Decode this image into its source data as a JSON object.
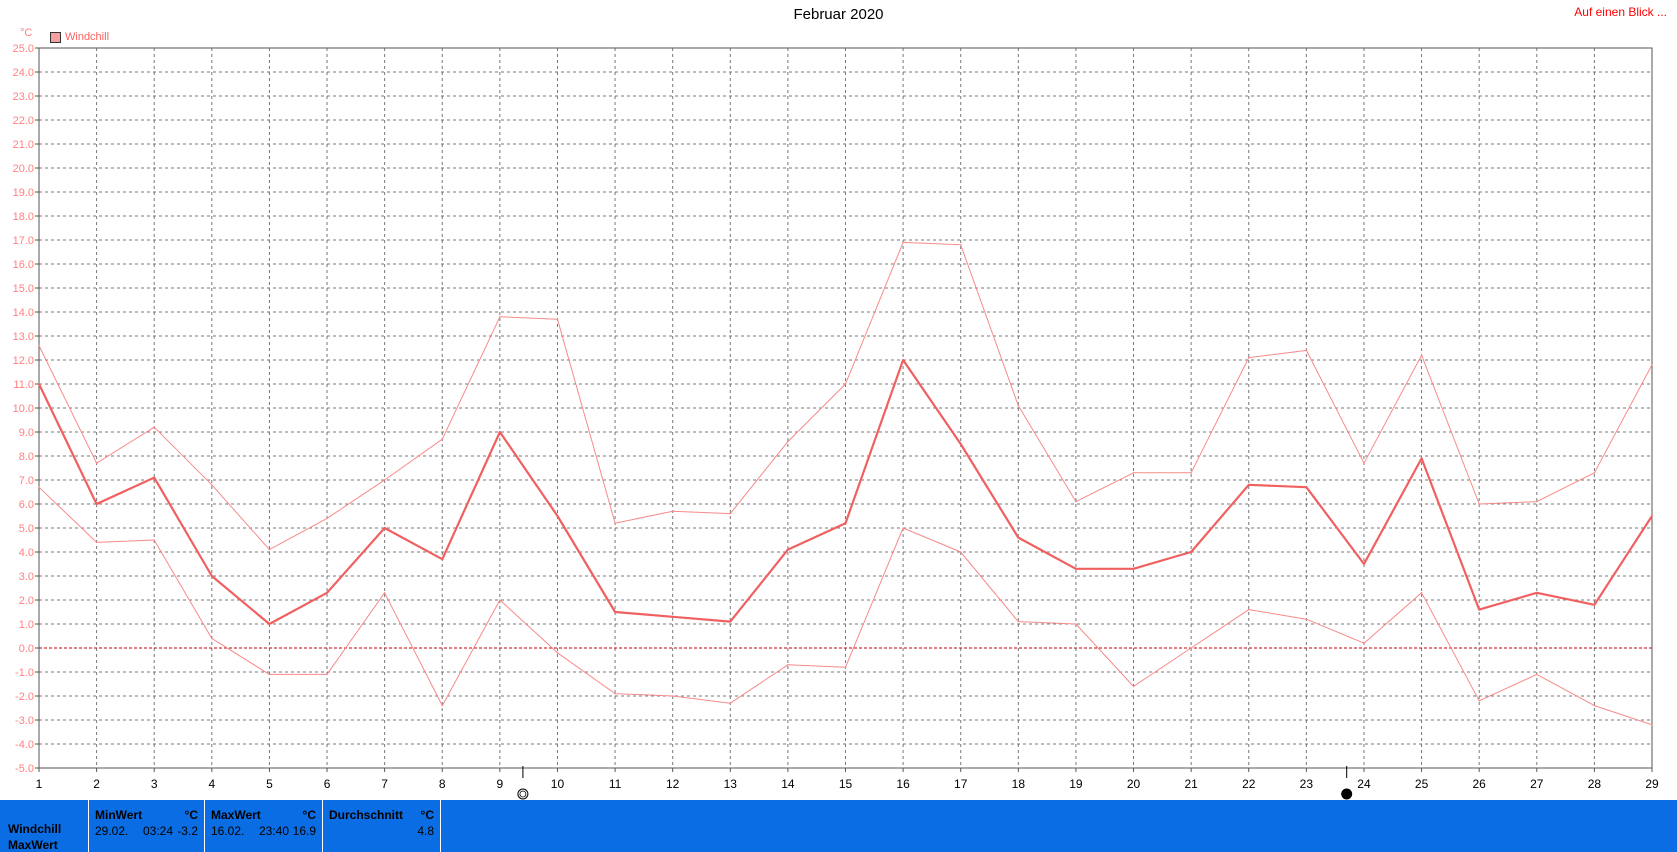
{
  "title": "Februar 2020",
  "link_label": "Auf einen Blick ...",
  "legend": {
    "label": "Windchill",
    "color": "#f4a0a0"
  },
  "colors": {
    "line": "#f06060",
    "zero_line": "#cc0000",
    "panel": "#0a6de4"
  },
  "chart_data": {
    "type": "line",
    "title": "Februar 2020",
    "ylabel": "°C",
    "ylim": [
      -5.0,
      25.0
    ],
    "y_ticks": [
      "25.0",
      "24.0",
      "23.0",
      "22.0",
      "21.0",
      "20.0",
      "19.0",
      "18.0",
      "17.0",
      "16.0",
      "15.0",
      "14.0",
      "13.0",
      "12.0",
      "11.0",
      "10.0",
      "9.0",
      "8.0",
      "7.0",
      "6.0",
      "5.0",
      "4.0",
      "3.0",
      "2.0",
      "1.0",
      "0.0",
      "-1.0",
      "-2.0",
      "-3.0",
      "-4.0",
      "-5.0"
    ],
    "x": [
      1,
      2,
      3,
      4,
      5,
      6,
      7,
      8,
      9,
      10,
      11,
      12,
      13,
      14,
      15,
      16,
      17,
      18,
      19,
      20,
      21,
      22,
      23,
      24,
      25,
      26,
      27,
      28,
      29
    ],
    "x_labels": [
      "1",
      "2",
      "3",
      "4",
      "5",
      "6",
      "7",
      "8",
      "9",
      "10",
      "11",
      "12",
      "13",
      "14",
      "15",
      "16",
      "17",
      "18",
      "19",
      "20",
      "21",
      "22",
      "23",
      "24",
      "25",
      "26",
      "27",
      "28",
      "29"
    ],
    "grid": true,
    "zero_line": 0.0,
    "moon_phases": [
      {
        "x": 9.4,
        "icon": "full-moon-icon"
      },
      {
        "x": 23.7,
        "icon": "new-moon-icon"
      }
    ],
    "series": [
      {
        "name": "Windchill",
        "role": "max",
        "values": [
          12.6,
          7.7,
          9.2,
          6.8,
          4.1,
          5.4,
          7.0,
          8.7,
          13.8,
          13.7,
          5.2,
          5.7,
          5.6,
          8.6,
          11.0,
          16.9,
          16.8,
          10.1,
          6.1,
          7.3,
          7.3,
          12.1,
          12.4,
          7.7,
          12.2,
          6.0,
          6.1,
          7.3,
          11.8
        ]
      },
      {
        "name": "Windchill",
        "role": "avg",
        "values": [
          11.0,
          6.0,
          7.1,
          3.0,
          1.0,
          2.3,
          5.0,
          3.7,
          9.0,
          5.5,
          1.5,
          1.3,
          1.1,
          4.1,
          5.2,
          12.0,
          8.5,
          4.6,
          3.3,
          3.3,
          4.0,
          6.8,
          6.7,
          3.5,
          7.9,
          1.6,
          2.3,
          1.8,
          5.5
        ]
      },
      {
        "name": "Windchill",
        "role": "min",
        "values": [
          6.7,
          4.4,
          4.5,
          0.4,
          -1.1,
          -1.1,
          2.3,
          -2.4,
          2.0,
          -0.2,
          -1.9,
          -2.0,
          -2.3,
          -0.7,
          -0.8,
          5.0,
          4.0,
          1.1,
          1.0,
          -1.6,
          0.0,
          1.6,
          1.2,
          0.2,
          2.3,
          -2.2,
          -1.1,
          -2.4,
          -3.2
        ]
      }
    ]
  },
  "stats": {
    "row_labels": [
      "Windchill",
      "MaxWert"
    ],
    "min": {
      "header": "MinWert",
      "unit": "°C",
      "date": "29.02.",
      "time": "03:24",
      "value": "-3.2"
    },
    "max": {
      "header": "MaxWert",
      "unit": "°C",
      "date": "16.02.",
      "time": "23:40",
      "value": "16.9"
    },
    "avg": {
      "header": "Durchschnitt",
      "unit": "°C",
      "value": "4.8"
    }
  }
}
